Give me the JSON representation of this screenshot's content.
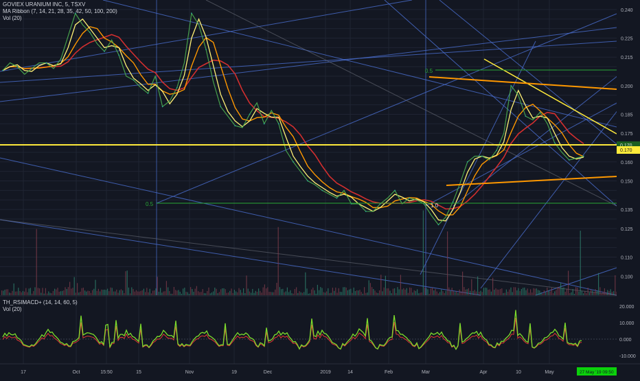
{
  "legend": {
    "symbol": "GOVIEX URANIUM INC, 5, TSXV",
    "ma_ribbon": "MA Ribbon (7, 14, 21, 28, 35, 42, 50, 100, 200)",
    "vol_top": "Vol (20)",
    "rsimacd": "TH_RSIMACD+ (14, 14, 60, 5)",
    "vol_bottom": "Vol (20)"
  },
  "colors": {
    "background": "#131722",
    "grid": "#1f2433",
    "yellow_line": "#ffeb3b",
    "orange_line": "#ff9800",
    "blue_lines": "#4a6fd1",
    "fib_green": "#2aa836",
    "price_tag": "#ffeb3b",
    "time_tag": "#0bd10b",
    "ma_red": "#d32f2f",
    "ma_orange": "#ff9800",
    "ma_yellow": "#fff176",
    "oscillator_green": "#7cdc2c",
    "oscillator_red": "#e53935"
  },
  "price_axis": {
    "min": 0.09,
    "max": 0.245,
    "ticks": [
      "0.240",
      "0.235",
      "0.230",
      "0.225",
      "0.220",
      "0.215",
      "0.210",
      "0.205",
      "0.200",
      "0.195",
      "0.190",
      "0.185",
      "0.180",
      "0.175",
      "0.170",
      "0.165",
      "0.160",
      "0.155",
      "0.150",
      "0.145",
      "0.140",
      "0.135",
      "0.130",
      "0.125",
      "0.120",
      "0.115",
      "0.110",
      "0.105",
      "0.100"
    ],
    "visible_ticks": [
      "0.240",
      "0.225",
      "0.215",
      "0.200",
      "0.185",
      "0.175",
      "0.160",
      "0.150",
      "0.135",
      "0.125",
      "0.110",
      "0.100"
    ],
    "last_price_labels": [
      "0.170",
      "0.170"
    ]
  },
  "osc_axis": {
    "ticks": [
      "20.000",
      "10.000",
      "0.000",
      "-10.000"
    ]
  },
  "time_axis": {
    "labels": [
      "17",
      "Oct",
      "15:50",
      "15",
      "Nov",
      "19",
      "Dec",
      "2019",
      "14",
      "Feb",
      "Mar",
      "Apr",
      "10",
      "May"
    ],
    "current_time_tag": "27 May '19  09:50"
  },
  "fib_labels": {
    "upper_level": "0.5",
    "lower_level": "0.5",
    "zero_label": "1.0"
  },
  "chart_data": {
    "type": "line",
    "title": "GOVIEX URANIUM INC, 5, TSXV",
    "xlabel": "",
    "ylabel": "",
    "ylim": [
      0.09,
      0.245
    ],
    "x": [
      "17",
      "Oct",
      "15:50",
      "15",
      "Nov",
      "19",
      "Dec",
      "2019",
      "14",
      "Feb",
      "Mar",
      "Apr",
      "10",
      "May"
    ],
    "series": [
      {
        "name": "GOVIEX URANIUM INC",
        "values": [
          0.208,
          0.212,
          0.21,
          0.206,
          0.209,
          0.212,
          0.212,
          0.209,
          0.214,
          0.226,
          0.238,
          0.232,
          0.228,
          0.222,
          0.218,
          0.224,
          0.216,
          0.205,
          0.203,
          0.199,
          0.196,
          0.205,
          0.189,
          0.192,
          0.199,
          0.212,
          0.238,
          0.232,
          0.219,
          0.202,
          0.189,
          0.184,
          0.179,
          0.178,
          0.185,
          0.191,
          0.18,
          0.187,
          0.18,
          0.166,
          0.16,
          0.155,
          0.15,
          0.148,
          0.145,
          0.143,
          0.141,
          0.145,
          0.138,
          0.138,
          0.134,
          0.134,
          0.138,
          0.141,
          0.145,
          0.138,
          0.141,
          0.14,
          0.138,
          0.132,
          0.127,
          0.131,
          0.139,
          0.149,
          0.16,
          0.163,
          0.163,
          0.161,
          0.166,
          0.175,
          0.2,
          0.195,
          0.184,
          0.182,
          0.186,
          0.18,
          0.17,
          0.165,
          0.161,
          0.162,
          0.163
        ]
      }
    ]
  }
}
